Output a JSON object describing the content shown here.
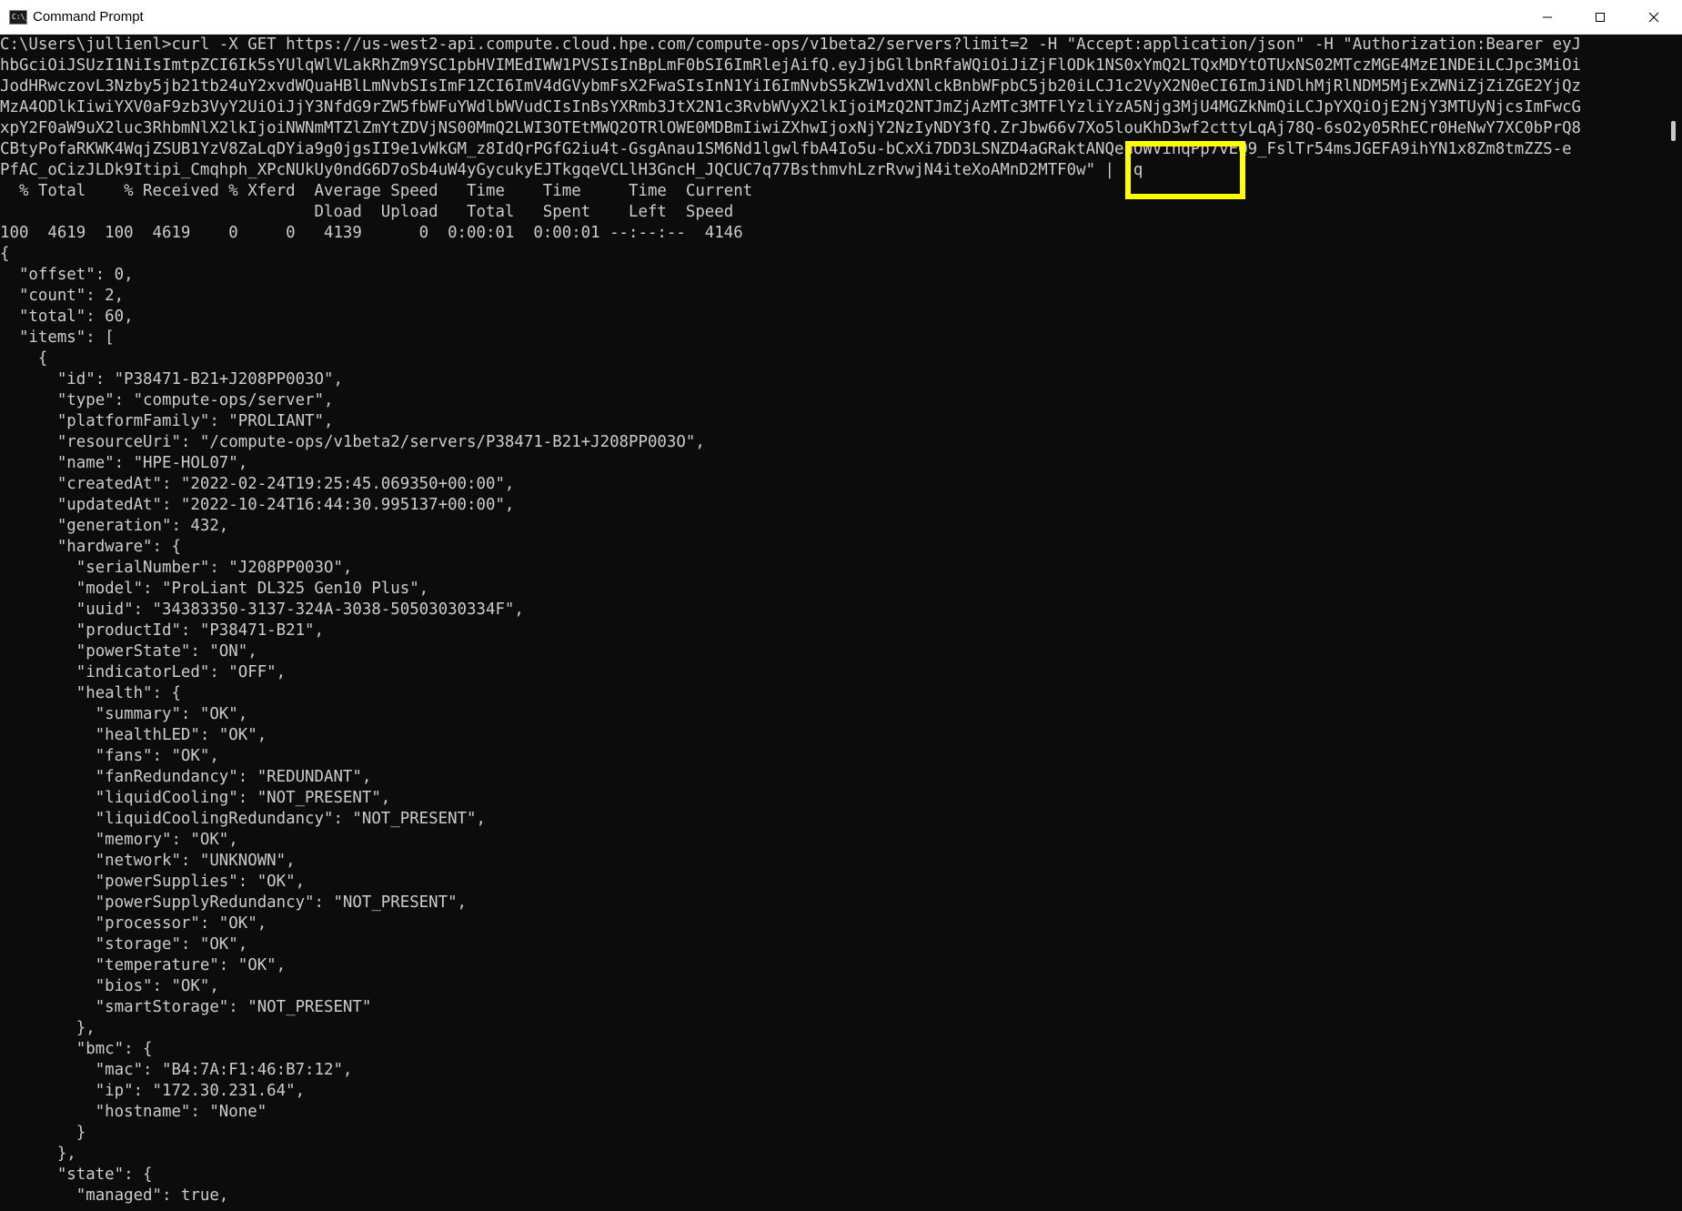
{
  "window": {
    "title": "Command Prompt",
    "icon": "C:\\_"
  },
  "controls": {
    "minimize_icon": "minimize-icon",
    "maximize_icon": "maximize-icon",
    "close_icon": "close-icon"
  },
  "colors": {
    "terminal_bg": "#0c0c0c",
    "terminal_fg": "#cccccc",
    "highlight": "#ffff00",
    "titlebar_bg": "#ffffff"
  },
  "terminal": {
    "lines": [
      "C:\\Users\\jullienl>curl -X GET https://us-west2-api.compute.cloud.hpe.com/compute-ops/v1beta2/servers?limit=2 -H \"Accept:application/json\" -H \"Authorization:Bearer eyJ",
      "hbGciOiJSUzI1NiIsImtpZCI6Ik5sYUlqWlVLakRhZm9YSC1pbHVIMEdIWW1PVSIsInBpLmF0bSI6ImRlejAifQ.eyJjbGllbnRfaWQiOiJiZjFlODk1NS0xYmQ2LTQxMDYtOTUxNS02MTczMGE4MzE1NDEiLCJpc3MiOi",
      "JodHRwczovL3Nzby5jb21tb24uY2xvdWQuaHBlLmNvbSIsImF1ZCI6ImV4dGVybmFsX2FwaSIsInN1YiI6ImNvbS5kZW1vdXNlckBnbWFpbC5jb20iLCJ1c2VyX2N0eCI6ImJiNDlhMjRlNDM5MjExZWNiZjZiZGE2YjQz",
      "MzA4ODlkIiwiYXV0aF9zb3VyY2UiOiJjY3NfdG9rZW5fbWFuYWdlbWVudCIsInBsYXRmb3JtX2N1c3RvbWVyX2lkIjoiMzQ2NTJmZjAzMTc3MTFlYzliYzA5Njg3MjU4MGZkNmQiLCJpYXQiOjE2NjY3MTUyNjcsImFwcG",
      "xpY2F0aW9uX2luc3RhbmNlX2lkIjoiNWNmMTZlZmYtZDVjNS00MmQ2LWI3OTEtMWQ2OTRlOWE0MDBmIiwiZXhwIjoxNjY2NzIyNDY3fQ.ZrJbw66v7Xo5louKhD3wf2cttyLqAj78Q-6sO2y05RhECr0HeNwY7XC0bPrQ8",
      "CBtyPofaRKWK4WqjZSUB1YzV8ZaLqDYia9g0jgsII9e1vWkGM_z8IdQrPGfG2iu4t-GsgAnau1SM6Nd1lgwlfbA4Io5u-bCxXi7DD3LSNZD4aGRaktANQenOWVinqPp7vEQ9_FslTr54msJGEFA9ihYN1x8Zm8tmZZS-e",
      "PfAC_oCizJLDk9Itipi_Cmqhph_XPcNUkUy0ndG6D7oSb4uW4yGycukyEJTkgqeVCLlH3GncH_JQCUC7q77BsthmvhLzrRvwjN4iteXoAMnD2MTF0w\" | jq",
      "  % Total    % Received % Xferd  Average Speed   Time    Time     Time  Current",
      "                                 Dload  Upload   Total   Spent    Left  Speed",
      "100  4619  100  4619    0     0   4139      0  0:00:01  0:00:01 --:--:--  4146",
      "{",
      "  \"offset\": 0,",
      "  \"count\": 2,",
      "  \"total\": 60,",
      "  \"items\": [",
      "    {",
      "      \"id\": \"P38471-B21+J208PP003O\",",
      "      \"type\": \"compute-ops/server\",",
      "      \"platformFamily\": \"PROLIANT\",",
      "      \"resourceUri\": \"/compute-ops/v1beta2/servers/P38471-B21+J208PP003O\",",
      "      \"name\": \"HPE-HOL07\",",
      "      \"createdAt\": \"2022-02-24T19:25:45.069350+00:00\",",
      "      \"updatedAt\": \"2022-10-24T16:44:30.995137+00:00\",",
      "      \"generation\": 432,",
      "      \"hardware\": {",
      "        \"serialNumber\": \"J208PP003O\",",
      "        \"model\": \"ProLiant DL325 Gen10 Plus\",",
      "        \"uuid\": \"34383350-3137-324A-3038-50503030334F\",",
      "        \"productId\": \"P38471-B21\",",
      "        \"powerState\": \"ON\",",
      "        \"indicatorLed\": \"OFF\",",
      "        \"health\": {",
      "          \"summary\": \"OK\",",
      "          \"healthLED\": \"OK\",",
      "          \"fans\": \"OK\",",
      "          \"fanRedundancy\": \"REDUNDANT\",",
      "          \"liquidCooling\": \"NOT_PRESENT\",",
      "          \"liquidCoolingRedundancy\": \"NOT_PRESENT\",",
      "          \"memory\": \"OK\",",
      "          \"network\": \"UNKNOWN\",",
      "          \"powerSupplies\": \"OK\",",
      "          \"powerSupplyRedundancy\": \"NOT_PRESENT\",",
      "          \"processor\": \"OK\",",
      "          \"storage\": \"OK\",",
      "          \"temperature\": \"OK\",",
      "          \"bios\": \"OK\",",
      "          \"smartStorage\": \"NOT_PRESENT\"",
      "        },",
      "        \"bmc\": {",
      "          \"mac\": \"B4:7A:F1:46:B7:12\",",
      "          \"ip\": \"172.30.231.64\",",
      "          \"hostname\": \"None\"",
      "        }",
      "      },",
      "      \"state\": {",
      "        \"managed\": true,"
    ]
  }
}
